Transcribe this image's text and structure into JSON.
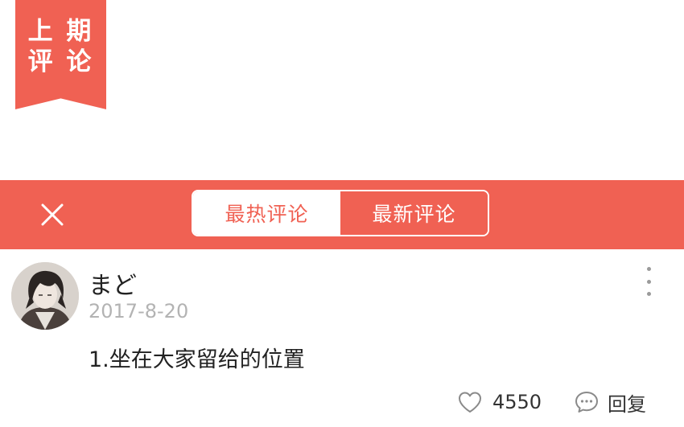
{
  "ribbon": {
    "line1": "上 期",
    "line2": "评 论",
    "color": "#f06153"
  },
  "tab_bar": {
    "close_icon": "close-icon",
    "tabs": [
      {
        "label": "最热评论",
        "active": true
      },
      {
        "label": "最新评论",
        "active": false
      }
    ],
    "color": "#f06153"
  },
  "comment": {
    "username": "まど",
    "date": "2017-8-20",
    "text": "1.坐在大家留给的位置",
    "like_count": "4550",
    "reply_label": "回复",
    "more_icon": "more-vertical-icon",
    "like_icon": "heart-outline-icon",
    "reply_icon": "comment-bubble-icon"
  }
}
